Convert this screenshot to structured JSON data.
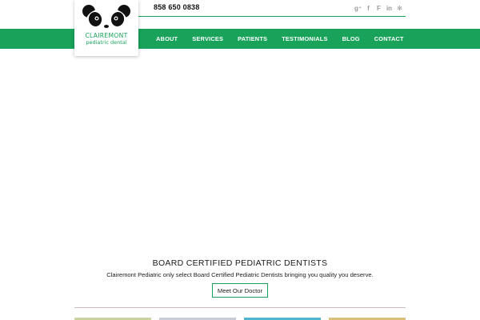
{
  "header": {
    "phone": "858 650 0838",
    "social_icons": [
      "google-plus-icon",
      "facebook-icon",
      "foursquare-icon",
      "linkedin-icon",
      "yelp-icon"
    ],
    "social_glyphs": [
      "g⁺",
      "f",
      "F",
      "in",
      "✻"
    ]
  },
  "logo": {
    "name": "CLAIREMONT",
    "subtitle": "pediatric dental"
  },
  "nav": {
    "items": [
      "ABOUT",
      "SERVICES",
      "PATIENTS",
      "TESTIMONIALS",
      "BLOG",
      "CONTACT"
    ]
  },
  "feature": {
    "headline": "BOARD CERTIFIED PEDIATRIC DENTISTS",
    "subline": "Clairemont Pediatric only select Board Certified Pediatric Dentists bringing you quality you deserve.",
    "cta_label": "Meet Our Doctor"
  },
  "colors": {
    "brand_green": "#19a35a",
    "text_dark": "#222222",
    "icon_gray": "#9a9a9a"
  }
}
